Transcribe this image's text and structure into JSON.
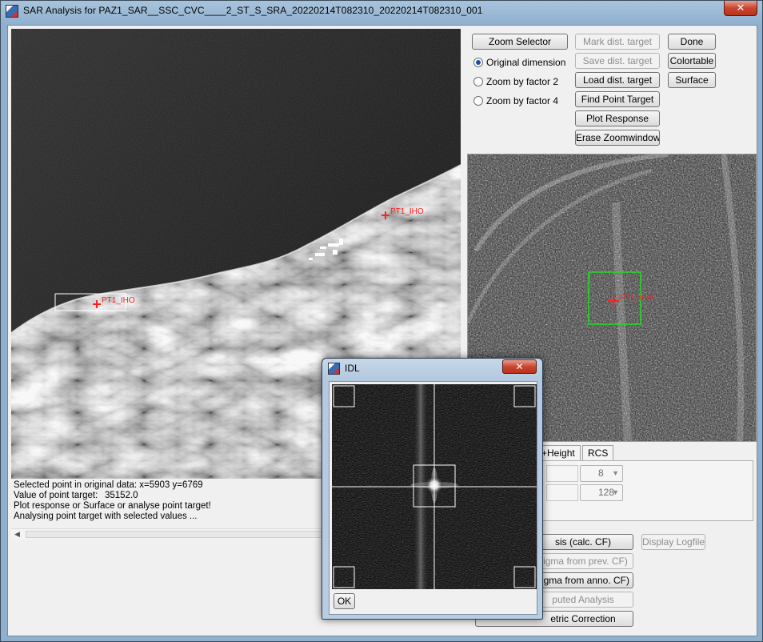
{
  "window": {
    "title": "SAR Analysis for PAZ1_SAR__SSC_CVC____2_ST_S_SRA_20220214T082310_20220214T082310_001",
    "close_glyph": "✕"
  },
  "controls": {
    "zoom_selector": "Zoom Selector",
    "radios": [
      {
        "label": "Original dimension",
        "selected": true
      },
      {
        "label": "Zoom by factor 2",
        "selected": false
      },
      {
        "label": "Zoom by factor 4",
        "selected": false
      }
    ],
    "mark_dist_target": "Mark dist. target",
    "save_dist_target": "Save dist. target",
    "load_dist_target": "Load dist. target",
    "find_point_target": "Find Point Target",
    "plot_response": "Plot Response",
    "erase_zoomwindow": "Erase Zoomwindow",
    "done": "Done",
    "colortable": "Colortable",
    "surface": "Surface"
  },
  "overlays": {
    "main_target_label": "PT1_IHO",
    "coast_target_label": "PT1_IHO",
    "zoom_target_label": "PT1_IHO"
  },
  "info": {
    "selected_point": "Selected point in original data: x=5903 y=6769",
    "value_label": "Value of point target:",
    "value": "35152.0",
    "hint": "Plot response or Surface or analyse point target!",
    "status": "Analysing point target with selected values ..."
  },
  "tabs": [
    {
      "label": "+Height"
    },
    {
      "label": "RCS"
    }
  ],
  "params": {
    "dd1": "8",
    "dd2": "128"
  },
  "analysis": {
    "calc_cf": "sis (calc. CF)",
    "display_logfile": "Display Logfile",
    "sigma_prev": "sigma from prev. CF)",
    "sigma_anno": "sigma from anno. CF)",
    "computed": "puted Analysis",
    "metric_correction": "etric Correction"
  },
  "idl_dialog": {
    "title": "IDL",
    "close_glyph": "✕",
    "ok": "OK"
  },
  "colors": {
    "target_marker": "#ff2020",
    "zoom_box": "#22dd22",
    "crosshair": "#ffffff"
  }
}
